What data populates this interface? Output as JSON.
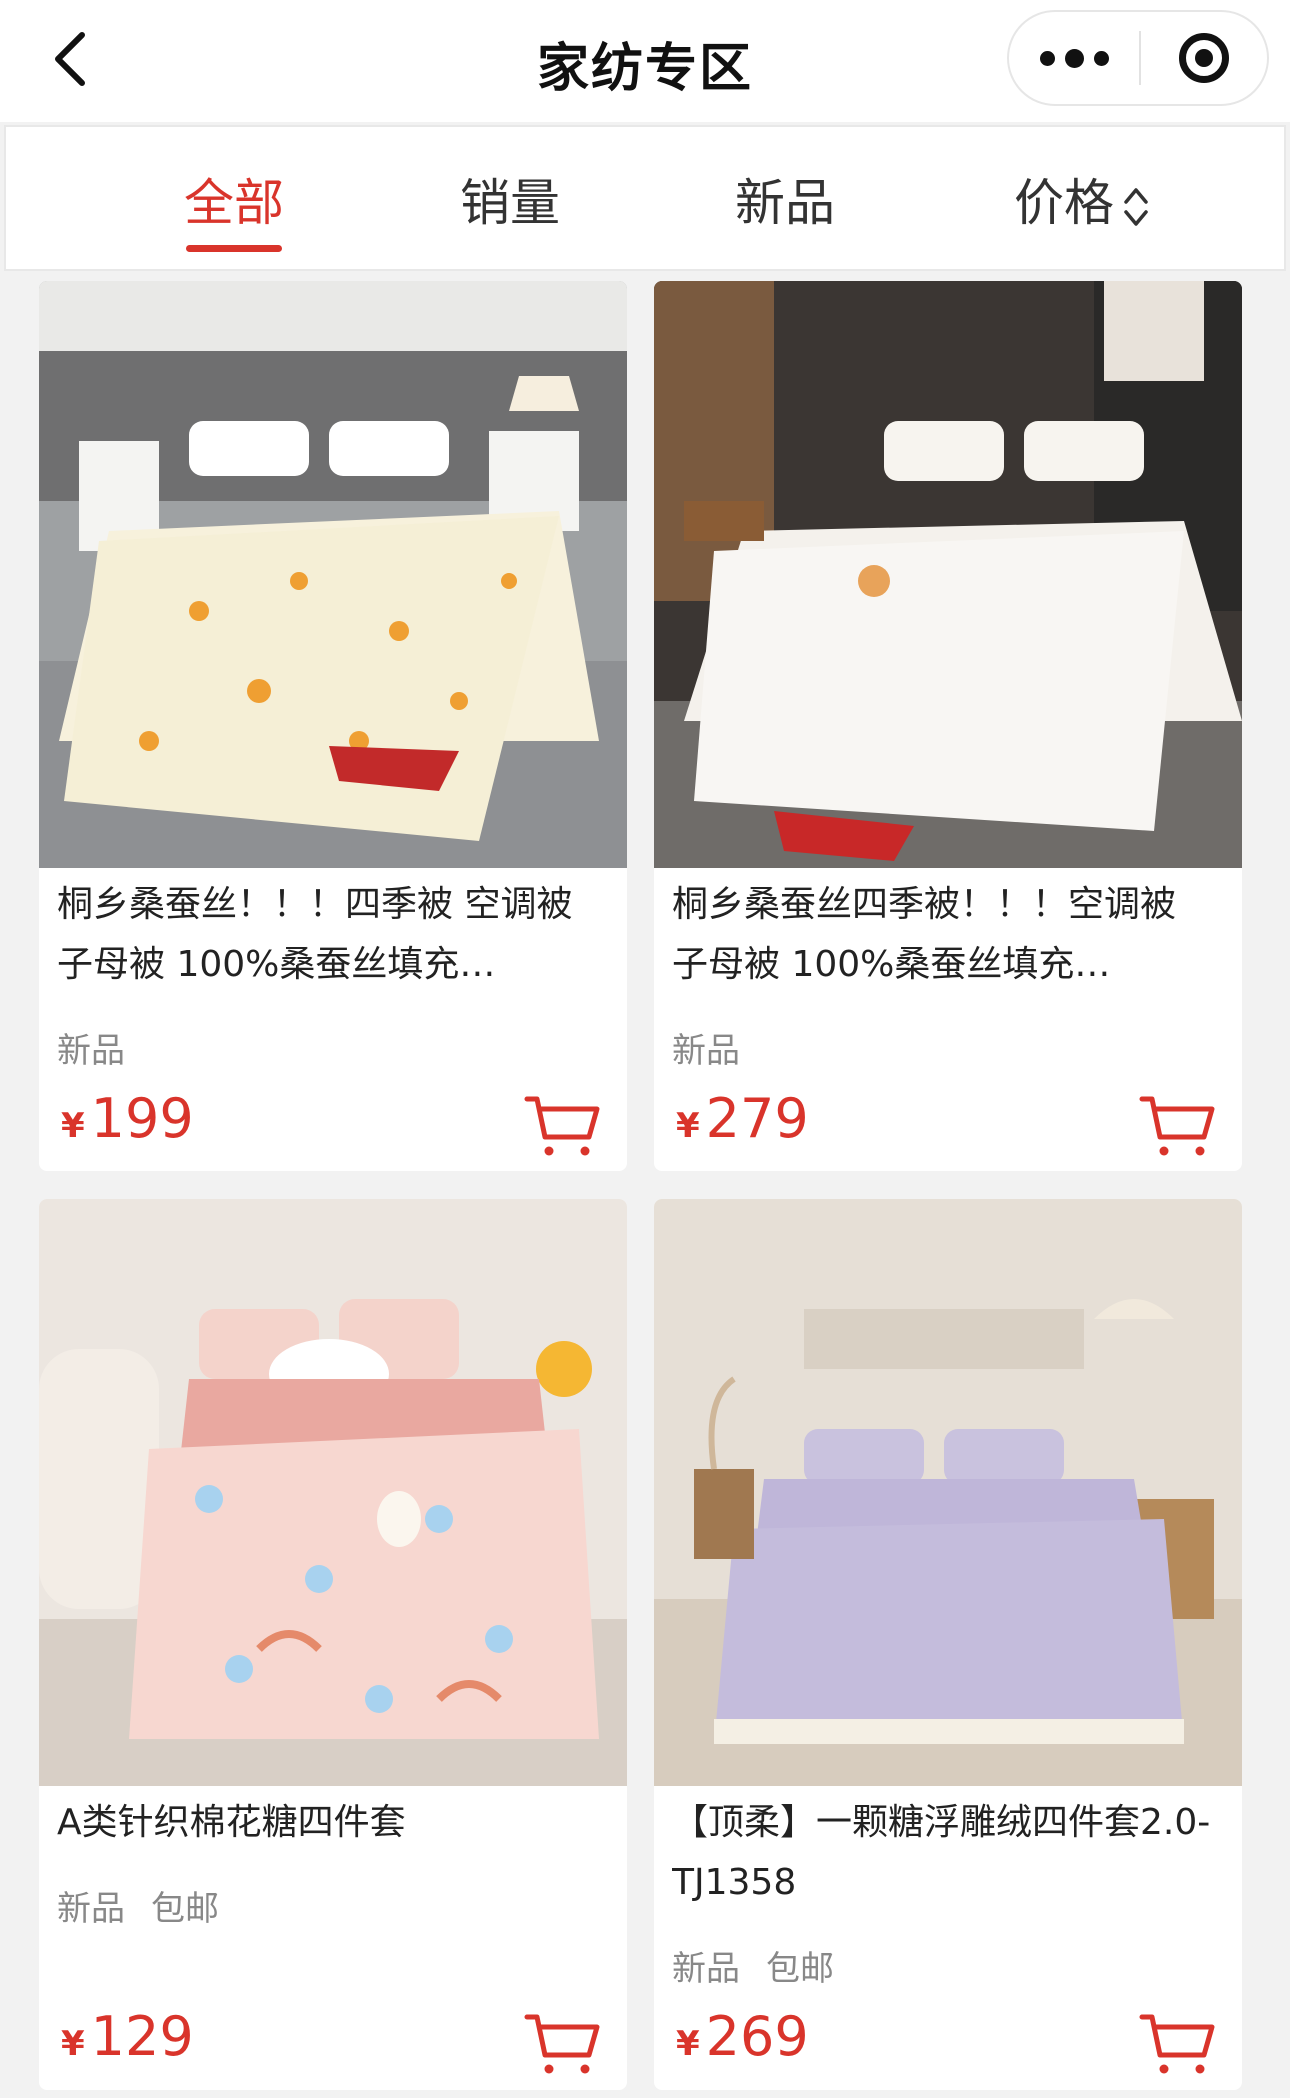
{
  "header": {
    "title": "家纺专区",
    "back_icon": "chevron-left-icon",
    "more_icon": "more-dots-icon",
    "target_icon": "target-icon"
  },
  "tabs": [
    {
      "label": "全部",
      "active": true
    },
    {
      "label": "销量",
      "active": false
    },
    {
      "label": "新品",
      "active": false
    },
    {
      "label": "价格",
      "active": false,
      "icon": "sort-updown-icon"
    }
  ],
  "products": [
    {
      "title": "桐乡桑蚕丝！！！四季被 空调被 子母被 100%桑蚕丝填充…",
      "tags": [
        "新品"
      ],
      "currency": "¥",
      "price": "199"
    },
    {
      "title": "桐乡桑蚕丝四季被！！！空调被 子母被 100%桑蚕丝填充…",
      "tags": [
        "新品"
      ],
      "currency": "¥",
      "price": "279"
    },
    {
      "title": "A类针织棉花糖四件套",
      "tags": [
        "新品",
        "包邮"
      ],
      "currency": "¥",
      "price": "129"
    },
    {
      "title": "【顶柔】一颗糖浮雕绒四件套2.0-TJ1358",
      "tags": [
        "新品",
        "包邮"
      ],
      "currency": "¥",
      "price": "269"
    }
  ],
  "colors": {
    "accent": "#d9342b",
    "background": "#f2f2f2"
  }
}
